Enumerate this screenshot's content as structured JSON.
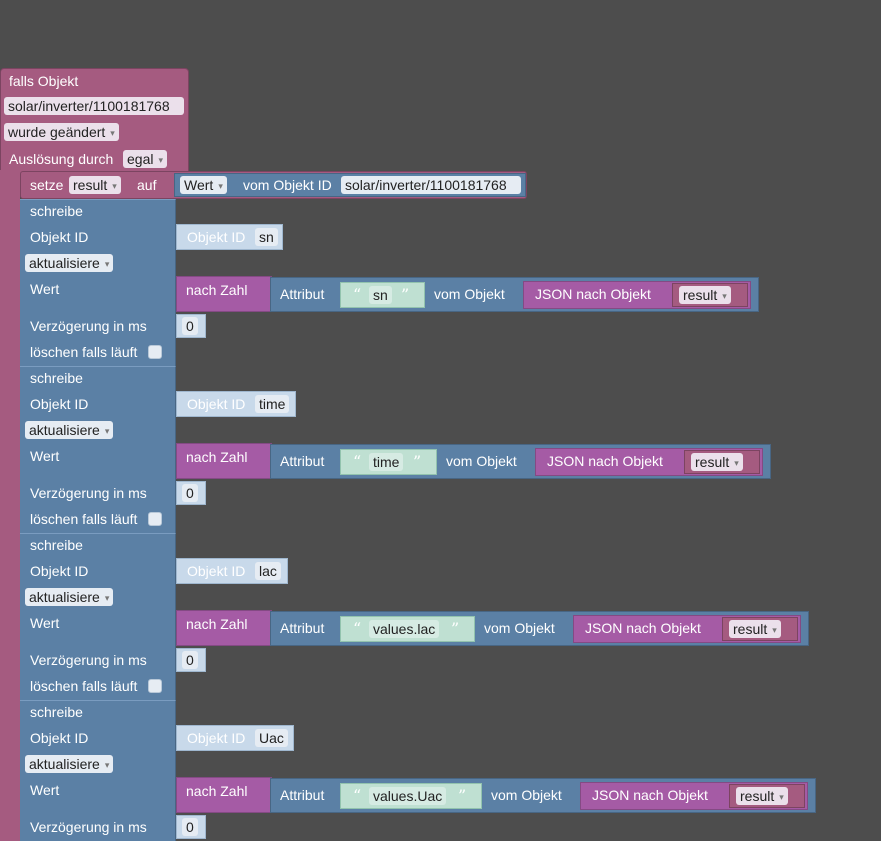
{
  "trigger": {
    "title": "falls Objekt",
    "object_id": "solar/inverter/1100181768",
    "condition": "wurde geändert",
    "trigger_label": "Auslösung durch",
    "trigger_value": "egal"
  },
  "setze": {
    "label": "setze",
    "variable": "result",
    "auf": "auf",
    "value_field": "Wert",
    "from_label": "vom Objekt ID",
    "object_id": "solar/inverter/1100181768"
  },
  "labels": {
    "schreibe": "schreibe",
    "objekt_id": "Objekt ID",
    "aktualisiere": "aktualisiere",
    "wert": "Wert",
    "nach_zahl": "nach Zahl",
    "attribut": "Attribut",
    "vom_objekt": "vom Objekt",
    "json_nach_objekt": "JSON nach Objekt",
    "verzoegerung": "Verzögerung in ms",
    "loeschen": "löschen falls läuft",
    "objekt_id_block": "Objekt ID"
  },
  "writes": [
    {
      "target": "sn",
      "attribute": "sn",
      "source_var": "result",
      "delay": "0"
    },
    {
      "target": "time",
      "attribute": "time",
      "source_var": "result",
      "delay": "0"
    },
    {
      "target": "lac",
      "attribute": "values.lac",
      "source_var": "result",
      "delay": "0"
    },
    {
      "target": "Uac",
      "attribute": "values.Uac",
      "source_var": "result",
      "delay": "0"
    }
  ],
  "colors": {
    "trigger": "#a55b80",
    "action": "#5b80a5",
    "convert": "#a55ba5",
    "text": "#bfe0d2",
    "background": "#4d4d4d"
  }
}
